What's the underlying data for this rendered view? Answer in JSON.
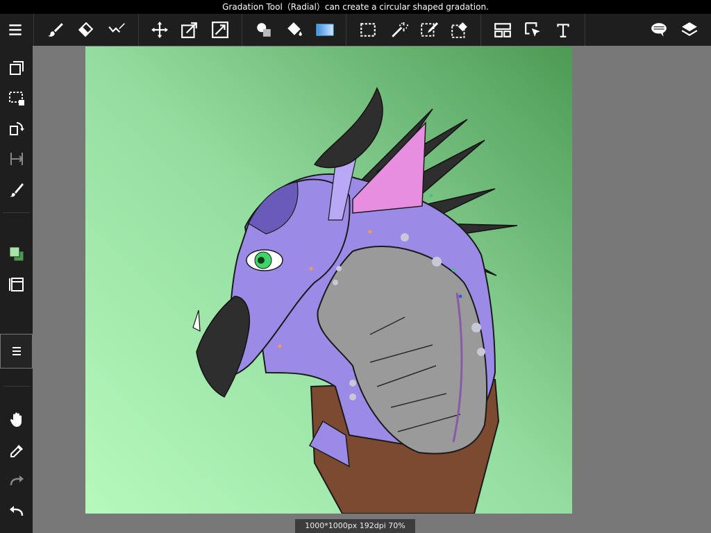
{
  "status_bar": {
    "message": "Gradation Tool（Radial）can create a circular shaped gradation."
  },
  "canvas_info": {
    "text": "1000*1000px 192dpi 70%"
  },
  "colors": {
    "accent": "#69c0ff",
    "main_color": "#a5e6a8",
    "sub_color": "#4a9a4e",
    "bar_bg": "#1e1e1e",
    "workspace": "#787878"
  },
  "toolbar": {
    "tools": [
      "menu-icon",
      "brush-icon",
      "eraser-icon",
      "stroke-correction-icon",
      "move-icon",
      "transform-icon",
      "scale-icon",
      "fill-shape-icon",
      "bucket-icon",
      "gradient-icon",
      "select-rect-icon",
      "magic-wand-icon",
      "select-pen-icon",
      "select-eraser-icon",
      "snap-icon",
      "select-object-icon",
      "text-icon",
      "speech-bubble-icon",
      "layers-icon"
    ]
  },
  "sidebar": {
    "tools": [
      "copy-layer-icon",
      "deselect-icon",
      "flip-icon",
      "ruler-icon",
      "brush-settings-icon",
      "color-icon",
      "layer-settings-icon",
      "layer-menu-icon",
      "hand-icon",
      "eyedropper-icon",
      "redo-icon",
      "undo-icon"
    ]
  }
}
